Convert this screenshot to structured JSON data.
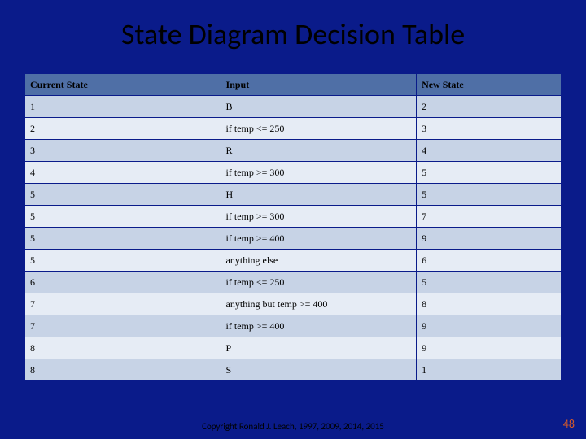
{
  "title": "State Diagram Decision Table",
  "headers": [
    "Current State",
    "Input",
    "New State"
  ],
  "rows": [
    {
      "current": "1",
      "input": "B",
      "next": "2"
    },
    {
      "current": "2",
      "input": "if temp <= 250",
      "next": "3"
    },
    {
      "current": "3",
      "input": "R",
      "next": "4"
    },
    {
      "current": "4",
      "input": "if temp >= 300",
      "next": "5"
    },
    {
      "current": "5",
      "input": "H",
      "next": "5"
    },
    {
      "current": "5",
      "input": "if temp >= 300",
      "next": "7"
    },
    {
      "current": "5",
      "input": "if temp >= 400",
      "next": "9"
    },
    {
      "current": "5",
      "input": "anything else",
      "next": "6"
    },
    {
      "current": "6",
      "input": "if temp <= 250",
      "next": "5"
    },
    {
      "current": "7",
      "input": "anything but temp >= 400",
      "next": "8"
    },
    {
      "current": "7",
      "input": "if temp >= 400",
      "next": "9"
    },
    {
      "current": "8",
      "input": "P",
      "next": "9"
    },
    {
      "current": "8",
      "input": "S",
      "next": "1"
    }
  ],
  "copyright": "Copyright Ronald J. Leach, 1997, 2009, 2014, 2015",
  "page_number": "48",
  "chart_data": {
    "type": "table",
    "title": "State Diagram Decision Table",
    "columns": [
      "Current State",
      "Input",
      "New State"
    ],
    "data": [
      [
        "1",
        "B",
        "2"
      ],
      [
        "2",
        "if temp <= 250",
        "3"
      ],
      [
        "3",
        "R",
        "4"
      ],
      [
        "4",
        "if temp >= 300",
        "5"
      ],
      [
        "5",
        "H",
        "5"
      ],
      [
        "5",
        "if temp >= 300",
        "7"
      ],
      [
        "5",
        "if temp >= 400",
        "9"
      ],
      [
        "5",
        "anything else",
        "6"
      ],
      [
        "6",
        "if temp <= 250",
        "5"
      ],
      [
        "7",
        "anything but temp >= 400",
        "8"
      ],
      [
        "7",
        "if temp >= 400",
        "9"
      ],
      [
        "8",
        "P",
        "9"
      ],
      [
        "8",
        "S",
        "1"
      ]
    ]
  }
}
